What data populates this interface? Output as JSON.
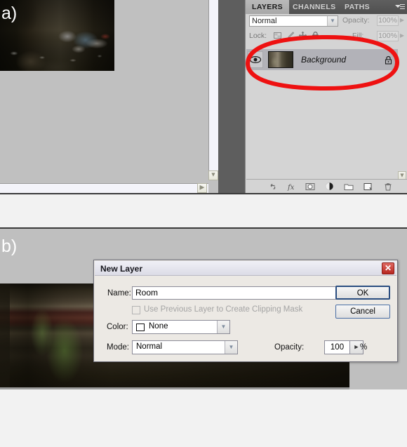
{
  "figure": {
    "label_a": "a)",
    "label_b": "b)"
  },
  "layers_panel": {
    "tabs": [
      {
        "label": "LAYERS",
        "active": true
      },
      {
        "label": "CHANNELS",
        "active": false
      },
      {
        "label": "PATHS",
        "active": false
      }
    ],
    "panel_menu_icon": "panel-menu-icon",
    "blend_mode": "Normal",
    "blend_dropdown_icon": "chevron-down-icon",
    "opacity_label": "Opacity:",
    "opacity_value": "100%",
    "opacity_stepper_icon": "chevron-right-icon",
    "lock_label": "Lock:",
    "lock_icons": [
      "transparency-lock-icon",
      "brush-lock-icon",
      "move-lock-icon",
      "lock-all-icon"
    ],
    "fill_label": "Fill:",
    "fill_value": "100%",
    "fill_stepper_icon": "chevron-right-icon",
    "layers": [
      {
        "name": "Background",
        "visible": true,
        "visibility_icon": "eye-icon",
        "lock_icon": "lock-icon",
        "thumbnail": "layer-thumbnail"
      }
    ],
    "bottom_toolbar": [
      {
        "icon": "link-layers-icon"
      },
      {
        "icon": "layer-style-fx-icon"
      },
      {
        "icon": "add-layer-mask-icon"
      },
      {
        "icon": "adjustment-layer-icon"
      },
      {
        "icon": "new-group-icon"
      },
      {
        "icon": "new-layer-icon"
      },
      {
        "icon": "delete-layer-icon"
      }
    ],
    "scrollbar_icon": "chevron-down-icon"
  },
  "canvas_a": {
    "scroll_down_icon": "chevron-down-icon",
    "scroll_right_icon": "chevron-right-icon",
    "image_alt": "derelict-room-photo"
  },
  "canvas_b": {
    "image_alt": "stone-archway-photo"
  },
  "annotation": {
    "shape": "red-ellipse-highlight",
    "color": "#ee1111"
  },
  "dialog": {
    "title": "New Layer",
    "close_icon": "close-icon",
    "name_label": "Name:",
    "name_value": "Room",
    "clipping_mask_label": "Use Previous Layer to Create Clipping Mask",
    "clipping_mask_checked": false,
    "color_label": "Color:",
    "color_value": "None",
    "color_dropdown_icon": "chevron-down-icon",
    "mode_label": "Mode:",
    "mode_value": "Normal",
    "mode_dropdown_icon": "chevron-down-icon",
    "opacity_label": "Opacity:",
    "opacity_value": "100",
    "opacity_stepper_icon": "play-right-icon",
    "percent_label": "%",
    "ok_label": "OK",
    "cancel_label": "Cancel"
  }
}
